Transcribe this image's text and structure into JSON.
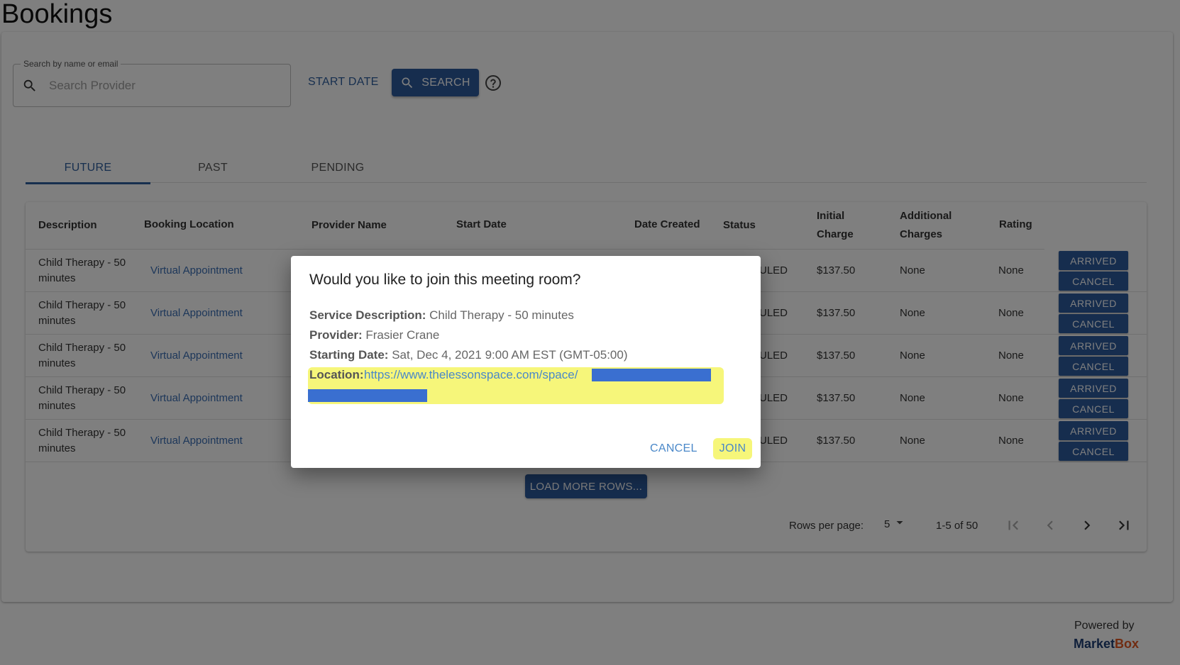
{
  "page": {
    "title": "Bookings"
  },
  "search": {
    "legend": "Search by name or email",
    "placeholder": "Search Provider",
    "start_date_label": "START DATE",
    "search_label": "SEARCH"
  },
  "tabs": [
    {
      "label": "FUTURE",
      "active": true
    },
    {
      "label": "PAST",
      "active": false
    },
    {
      "label": "PENDING",
      "active": false
    }
  ],
  "table": {
    "headers": {
      "description": "Description",
      "booking_location": "Booking Location",
      "provider_name": "Provider Name",
      "start_date": "Start Date",
      "date_created": "Date Created",
      "status": "Status",
      "initial_charge_1": "Initial",
      "initial_charge_2": "Charge",
      "additional_charges_1": "Additional",
      "additional_charges_2": "Charges",
      "rating": "Rating"
    },
    "rows": [
      {
        "desc": "Child Therapy - 50 minutes",
        "location": "Virtual Appointment",
        "status": "ULED",
        "charge": "$137.50",
        "additional": "None",
        "rating": "None",
        "arrived": "ARRIVED",
        "cancel": "CANCEL"
      },
      {
        "desc": "Child Therapy - 50 minutes",
        "location": "Virtual Appointment",
        "status": "ULED",
        "charge": "$137.50",
        "additional": "None",
        "rating": "None",
        "arrived": "ARRIVED",
        "cancel": "CANCEL"
      },
      {
        "desc": "Child Therapy - 50 minutes",
        "location": "Virtual Appointment",
        "status": "ULED",
        "charge": "$137.50",
        "additional": "None",
        "rating": "None",
        "arrived": "ARRIVED",
        "cancel": "CANCEL"
      },
      {
        "desc": "Child Therapy - 50 minutes",
        "location": "Virtual Appointment",
        "status": "ULED",
        "charge": "$137.50",
        "additional": "None",
        "rating": "None",
        "arrived": "ARRIVED",
        "cancel": "CANCEL"
      },
      {
        "desc": "Child Therapy - 50 minutes",
        "location": "Virtual Appointment",
        "status": "ULED",
        "charge": "$137.50",
        "additional": "None",
        "rating": "None",
        "arrived": "ARRIVED",
        "cancel": "CANCEL"
      }
    ],
    "load_more": "LOAD MORE ROWS...",
    "pagination": {
      "rows_per_page_label": "Rows per page:",
      "rows_per_page_value": "5",
      "range": "1-5 of 50"
    }
  },
  "dialog": {
    "title": "Would you like to join this meeting room?",
    "service_label": "Service Description:",
    "service_value": "Child Therapy - 50 minutes",
    "provider_label": "Provider:",
    "provider_value": "Frasier Crane",
    "start_label": "Starting Date:",
    "start_value": "Sat, Dec 4, 2021 9:00 AM EST (GMT-05:00)",
    "location_label": "Location:",
    "location_value": "https://www.thelessonspace.com/space/",
    "cancel_label": "CANCEL",
    "join_label": "JOIN"
  },
  "footer": {
    "powered_by": "Powered by",
    "brand_market": "Market",
    "brand_box": "Box"
  },
  "colors": {
    "primary": "#2d5a9c",
    "link": "#3b6eb4",
    "highlight": "#f6f67a",
    "redaction": "#3a6fd0",
    "brand_orange": "#e25822"
  }
}
